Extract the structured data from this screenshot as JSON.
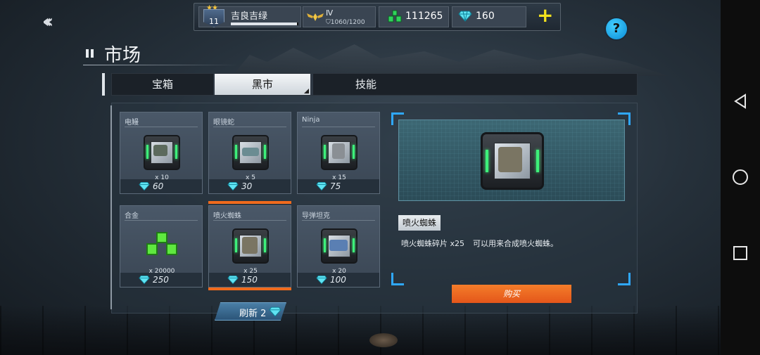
{
  "colors": {
    "accent_orange": "#f06a1c",
    "buy_orange": "#f47d2a",
    "frame_blue": "#2fa8ff",
    "plus_yellow": "#f3e21e",
    "led_green": "#3df07a"
  },
  "nav": {
    "back_icon": "double-chevron-left-icon"
  },
  "hud": {
    "rank_level": "11",
    "rank_stars": "★★",
    "player_name": "吉良吉绿",
    "xp_fraction": 0.98,
    "league_tier": "Ⅳ",
    "league_points": "1060/1200",
    "alloy_amount": "111265",
    "gems_amount": "160",
    "plus_label": "+"
  },
  "help_label": "?",
  "page_title": "市场",
  "tabs": [
    "宝箱",
    "黑市",
    "技能"
  ],
  "active_tab": "黑市",
  "items": [
    {
      "name": "电鳗",
      "qty": "x 10",
      "price": "60"
    },
    {
      "name": "眼镜蛇",
      "qty": "x 5",
      "price": "30"
    },
    {
      "name": "Ninja",
      "qty": "x 15",
      "price": "75"
    },
    {
      "name": "合金",
      "qty": "x 20000",
      "price": "250"
    },
    {
      "name": "喷火蜘蛛",
      "qty": "x 25",
      "price": "150"
    },
    {
      "name": "导弹坦克",
      "qty": "x 20",
      "price": "100"
    }
  ],
  "selected_item": "喷火蜘蛛",
  "refresh": {
    "label": "刷新 2"
  },
  "detail": {
    "name": "喷火蜘蛛",
    "desc_fragments": "喷火蜘蛛碎片 x25",
    "desc_use": "可以用来合成喷火蜘蛛。"
  },
  "buy_label": "购买"
}
